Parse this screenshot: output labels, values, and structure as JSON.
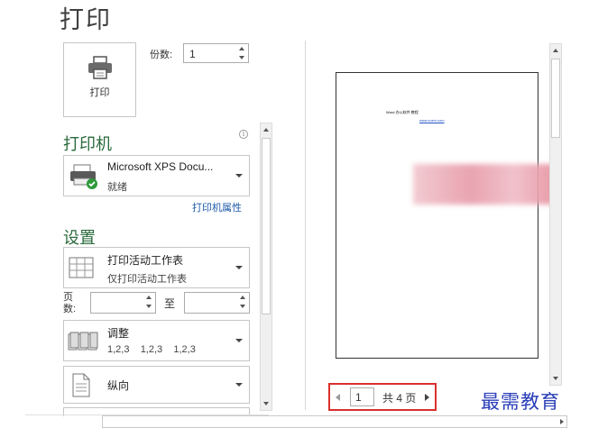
{
  "page": {
    "title": "打印"
  },
  "print": {
    "button_label": "打印",
    "copies_label": "份数:",
    "copies_value": "1"
  },
  "printer": {
    "heading": "打印机",
    "info_glyph": "i",
    "name": "Microsoft XPS Docu...",
    "status": "就绪",
    "properties_link": "打印机属性"
  },
  "settings": {
    "heading": "设置",
    "scope": {
      "title": "打印活动工作表",
      "subtitle": "仅打印活动工作表"
    },
    "pages": {
      "label": "页数:",
      "to_label": "至",
      "from_value": "",
      "to_value": ""
    },
    "collate": {
      "title": "调整",
      "subtitle": "1,2,3    1,2,3    1,2,3"
    },
    "orientation": {
      "title": "纵向"
    }
  },
  "preview": {
    "page_title_text": "Word 办公软件 教程",
    "page_link_text": "www.xuexi.com",
    "current_page": "1",
    "total_label": "共 4 页"
  },
  "watermark": {
    "text": "最需教育"
  },
  "colors": {
    "accent_green": "#2a6a3c",
    "link_blue": "#1e5aa8",
    "pager_border": "#d9302c",
    "watermark": "#2a3eb8"
  }
}
